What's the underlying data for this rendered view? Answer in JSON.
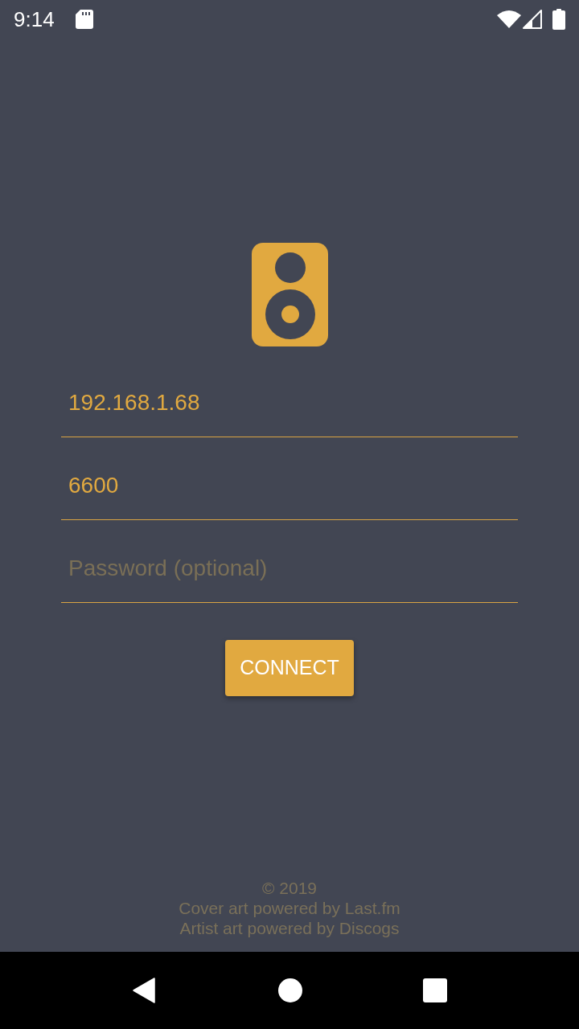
{
  "status_bar": {
    "time": "9:14"
  },
  "form": {
    "fields": [
      {
        "value": "192.168.1.68"
      },
      {
        "value": "6600"
      },
      {
        "placeholder": "Password (optional)"
      }
    ],
    "button": "CONNECT"
  },
  "footer": {
    "lines": [
      "© 2019",
      "Cover art powered by Last.fm",
      "Artist art powered by Discogs"
    ]
  }
}
